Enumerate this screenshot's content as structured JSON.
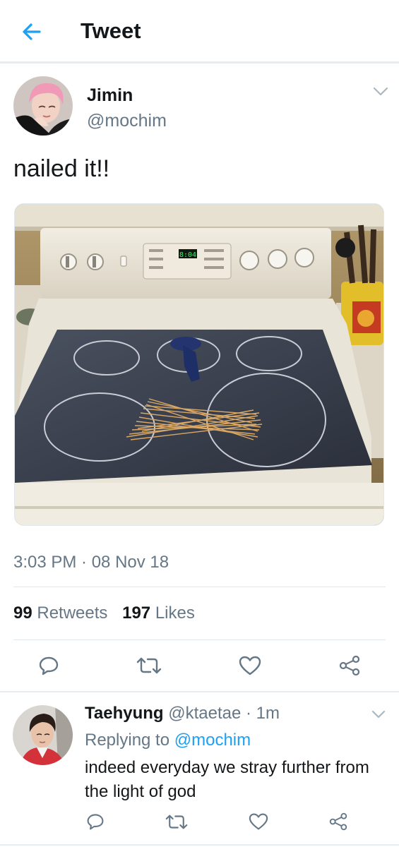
{
  "header": {
    "title": "Tweet"
  },
  "tweet": {
    "author_name": "Jimin",
    "author_handle": "@mochim",
    "text": "nailed it!!",
    "image_display": "8:04",
    "timestamp": "3:03 PM · 08 Nov 18",
    "retweet_count": "99",
    "retweet_label": "Retweets",
    "like_count": "197",
    "like_label": "Likes"
  },
  "reply": {
    "author_name": "Taehyung",
    "author_handle": "@ktaetae",
    "time": "· 1m",
    "replying_prefix": "Replying to",
    "replying_handle": "@mochim",
    "text": "indeed everyday we stray further from the light of god"
  },
  "icons": {
    "back": "arrow-left",
    "caret": "chevron-down",
    "reply": "speech-bubble",
    "retweet": "retweet-arrows",
    "like": "heart-outline",
    "share": "share-nodes"
  },
  "colors": {
    "accent": "#1da1f2",
    "secondary_text": "#657786",
    "primary_text": "#14171a",
    "divider": "#e1e8ed"
  }
}
